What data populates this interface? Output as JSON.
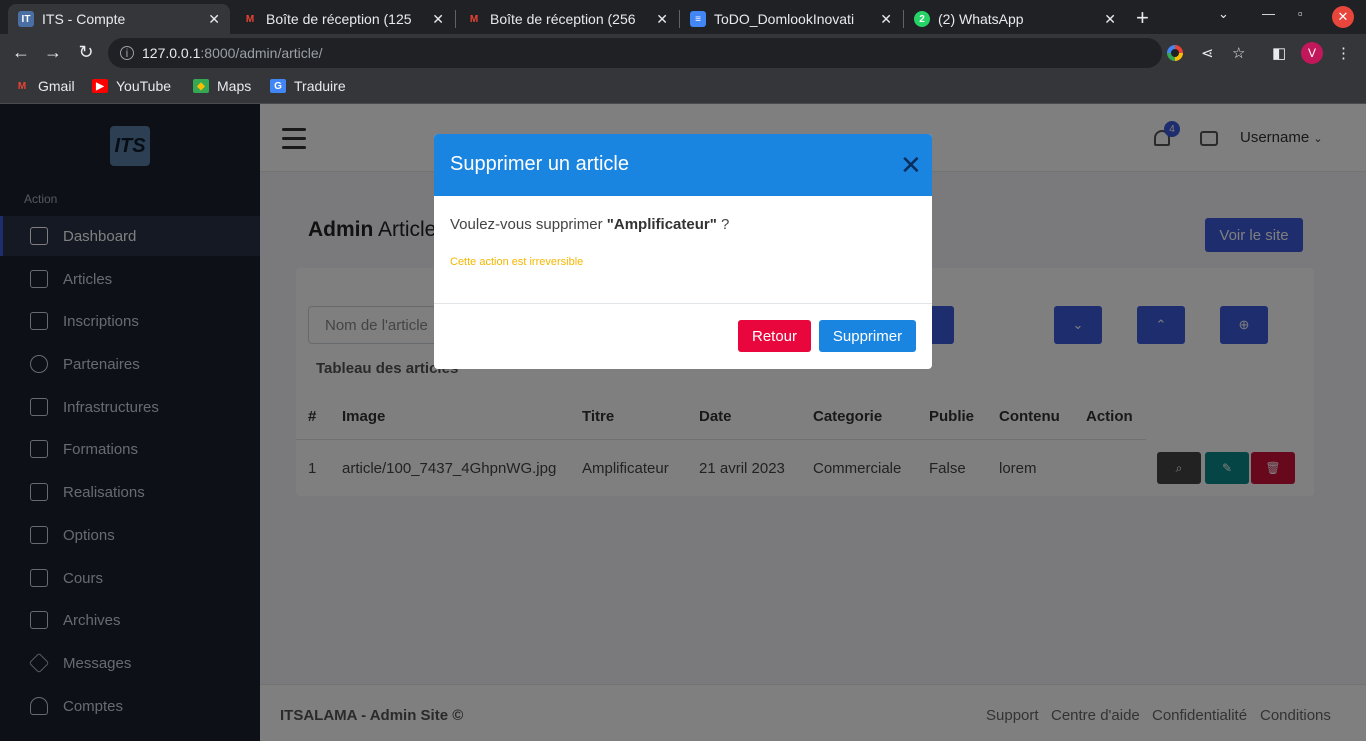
{
  "browser": {
    "tabs": [
      {
        "label": "ITS - Compte",
        "favicon": "its-favicon",
        "active": true
      },
      {
        "label": "Boîte de réception (125",
        "favicon": "gmail-favicon",
        "active": false
      },
      {
        "label": "Boîte de réception (256",
        "favicon": "gmail-favicon",
        "active": false
      },
      {
        "label": "ToDO_DomlookInovati",
        "favicon": "docs-favicon",
        "active": false
      },
      {
        "label": "(2) WhatsApp",
        "favicon": "whatsapp-favicon",
        "active": false
      }
    ],
    "url_host": "127.0.0.1",
    "url_path": ":8000/admin/article/",
    "profile_initial": "V",
    "bookmarks": [
      {
        "label": "Gmail",
        "icon": "gmail-icon"
      },
      {
        "label": "YouTube",
        "icon": "youtube-icon"
      },
      {
        "label": "Maps",
        "icon": "maps-icon"
      },
      {
        "label": "Traduire",
        "icon": "translate-icon"
      }
    ]
  },
  "sidebar": {
    "section_label": "Action",
    "logo_text": "ITS",
    "items": [
      {
        "label": "Dashboard",
        "icon": "home-icon",
        "active": true
      },
      {
        "label": "Articles",
        "icon": "send-icon"
      },
      {
        "label": "Inscriptions",
        "icon": "mail-icon"
      },
      {
        "label": "Partenaires",
        "icon": "award-icon"
      },
      {
        "label": "Infrastructures",
        "icon": "map-icon"
      },
      {
        "label": "Formations",
        "icon": "briefcase-icon"
      },
      {
        "label": "Realisations",
        "icon": "cast-icon"
      },
      {
        "label": "Options",
        "icon": "monitor-icon"
      },
      {
        "label": "Cours",
        "icon": "book-icon"
      },
      {
        "label": "Archives",
        "icon": "inbox-icon"
      },
      {
        "label": "Messages",
        "icon": "layers-icon"
      },
      {
        "label": "Comptes",
        "icon": "users-icon"
      }
    ]
  },
  "topbar": {
    "notification_count": "4",
    "username": "Username"
  },
  "page": {
    "title_bold": "Admin",
    "title_rest": "Article",
    "view_site_label": "Voir le site",
    "search_placeholder": "Nom de l'article",
    "table_title": "Tableau des articles",
    "columns": [
      "#",
      "Image",
      "Titre",
      "Date",
      "Categorie",
      "Publie",
      "Contenu",
      "Action"
    ],
    "rows": [
      {
        "num": "1",
        "image": "article/100_7437_4GhpnWG.jpg",
        "titre": "Amplificateur",
        "date": "21 avril 2023",
        "categorie": "Commerciale",
        "publie": "False",
        "contenu": "lorem"
      }
    ]
  },
  "footer": {
    "brand": "ITSALAMA - Admin Site ©",
    "links": [
      "Support",
      "Centre d'aide",
      "Confidentialité",
      "Conditions"
    ]
  },
  "modal": {
    "title": "Supprimer un article",
    "question_prefix": "Voulez-vous supprimer ",
    "item_name": "\"Amplificateur\"",
    "question_suffix": " ?",
    "warning": "Cette action est irreversible",
    "cancel_label": "Retour",
    "confirm_label": "Supprimer"
  },
  "colors": {
    "modal_header": "#1a85e0",
    "danger": "#e8063c",
    "warning": "#f5b700",
    "primary": "#3b5bdb",
    "sidebar": "#1a202e"
  }
}
